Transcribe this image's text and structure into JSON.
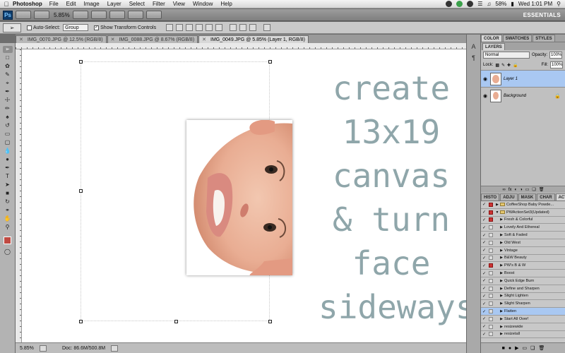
{
  "menubar": {
    "app_name": "Photoshop",
    "items": [
      "File",
      "Edit",
      "Image",
      "Layer",
      "Select",
      "Filter",
      "View",
      "Window",
      "Help"
    ],
    "battery": "58%",
    "clock": "Wed 1:01 PM"
  },
  "appbar": {
    "logo": "Ps",
    "zoom": "5.85%",
    "workspace": "ESSENTIALS"
  },
  "optbar": {
    "auto_select_label": "Auto-Select:",
    "auto_select_value": "Group",
    "show_transform_label": "Show Transform Controls"
  },
  "tabs": [
    {
      "label": "IMG_0070.JPG @ 12.5% (RGB/8)",
      "active": false
    },
    {
      "label": "IMG_0088.JPG @ 8.67% (RGB/8)",
      "active": false
    },
    {
      "label": "IMG_0049.JPG @ 5.85% (Layer 1, RGB/8)",
      "active": true
    }
  ],
  "canvas": {
    "lines": [
      "create",
      "13x19",
      "canvas",
      "& turn",
      "face",
      "sideways"
    ]
  },
  "status": {
    "zoom": "5.85%",
    "doc": "Doc: 86.6M/500.8M"
  },
  "panels": {
    "top_tabs": [
      "COLOR",
      "SWATCHES",
      "STYLES"
    ],
    "layers_tab": "LAYERS",
    "blend_mode": "Normal",
    "opacity_label": "Opacity:",
    "opacity_value": "100%",
    "lock_label": "Lock:",
    "fill_label": "Fill:",
    "fill_value": "100%",
    "layers": [
      {
        "name": "Layer 1",
        "selected": true
      },
      {
        "name": "Background",
        "selected": false
      }
    ],
    "action_tabs": [
      "HISTO",
      "ADJU",
      "MASK",
      "CHAR",
      "ACTIONS"
    ],
    "actions": [
      {
        "label": "CoffeeShop Baby Powde...",
        "check": true,
        "red": true,
        "folder": true,
        "open": false
      },
      {
        "label": "PWActionSet3(Updated)",
        "check": true,
        "red": true,
        "folder": true,
        "open": true
      },
      {
        "label": "Fresh & Colorful",
        "check": true,
        "red": true,
        "folder": false
      },
      {
        "label": "Lovely And Ethereal",
        "check": true,
        "red": false,
        "folder": false
      },
      {
        "label": "Soft & Faded",
        "check": true,
        "red": false,
        "folder": false
      },
      {
        "label": "Old West",
        "check": true,
        "red": false,
        "folder": false
      },
      {
        "label": "Vintage",
        "check": true,
        "red": false,
        "folder": false
      },
      {
        "label": "B&W Beauty",
        "check": true,
        "red": false,
        "folder": false
      },
      {
        "label": "PW's B & W",
        "check": true,
        "red": true,
        "folder": false
      },
      {
        "label": "Boost",
        "check": true,
        "red": false,
        "folder": false
      },
      {
        "label": "Quick Edge Burn",
        "check": true,
        "red": false,
        "folder": false
      },
      {
        "label": "Define and Sharpen",
        "check": true,
        "red": false,
        "folder": false
      },
      {
        "label": "Slight Lighten",
        "check": true,
        "red": false,
        "folder": false
      },
      {
        "label": "Slight Sharpen",
        "check": true,
        "red": false,
        "folder": false
      },
      {
        "label": "Flatten",
        "check": true,
        "red": false,
        "folder": false,
        "selected": true
      },
      {
        "label": "Start All Over!",
        "check": true,
        "red": false,
        "folder": false
      },
      {
        "label": "resizewide",
        "check": true,
        "red": false,
        "folder": false
      },
      {
        "label": "resizetall",
        "check": true,
        "red": false,
        "folder": false
      }
    ]
  },
  "colors": {
    "text_overlay": "#8fa6aa",
    "foreground_swatch": "#c04a42",
    "selection": "#a9c8f2"
  }
}
